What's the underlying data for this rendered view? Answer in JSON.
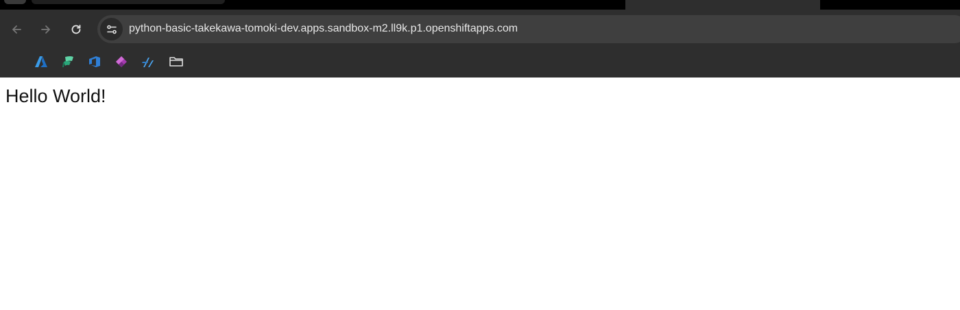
{
  "browser": {
    "address_bar": {
      "url": "python-basic-takekawa-tomoki-dev.apps.sandbox-m2.ll9k.p1.openshiftapps.com",
      "site_info_icon": "tune-icon"
    },
    "nav": {
      "back_icon": "back-arrow-icon",
      "forward_icon": "forward-arrow-icon",
      "reload_icon": "reload-icon"
    },
    "bookmarks": [
      {
        "icon": "azure-icon"
      },
      {
        "icon": "fabric-icon"
      },
      {
        "icon": "azure-devops-icon"
      },
      {
        "icon": "power-apps-icon"
      },
      {
        "icon": "azure-functions-icon"
      },
      {
        "icon": "folder-icon"
      }
    ],
    "colors": {
      "chrome_bg": "#2e2e2e",
      "omnibox_bg": "#3f3f3f",
      "tabstrip_bg": "#000000",
      "url_text": "#e8e8e8"
    }
  },
  "page": {
    "body_text": "Hello World!"
  }
}
